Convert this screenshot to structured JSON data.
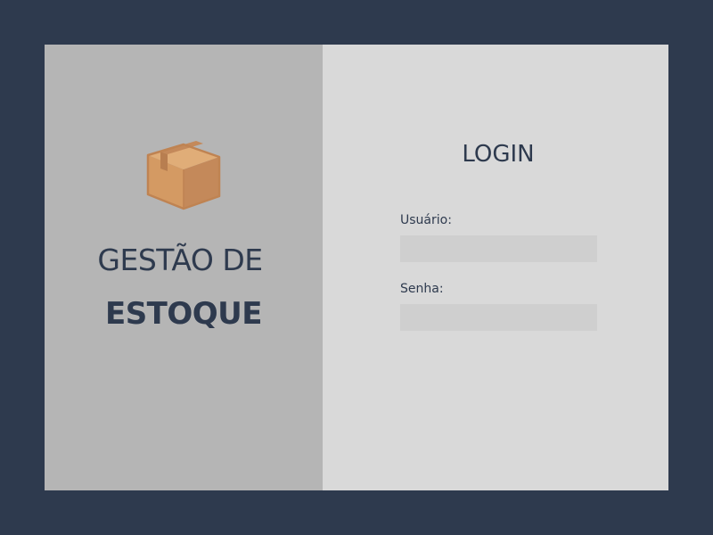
{
  "brand": {
    "icon": "package-box-icon",
    "line1": "GESTÃO DE",
    "line2": "ESTOQUE"
  },
  "login": {
    "title": "LOGIN",
    "username_label": "Usuário:",
    "username_value": "",
    "password_label": "Senha:",
    "password_value": ""
  },
  "colors": {
    "background": "#2e3a4e",
    "left_panel": "#b5b5b5",
    "right_panel": "#d9d9d9",
    "input_bg": "#cfcfcf",
    "text": "#2e3a4e",
    "box_orange": "#d49a63"
  }
}
